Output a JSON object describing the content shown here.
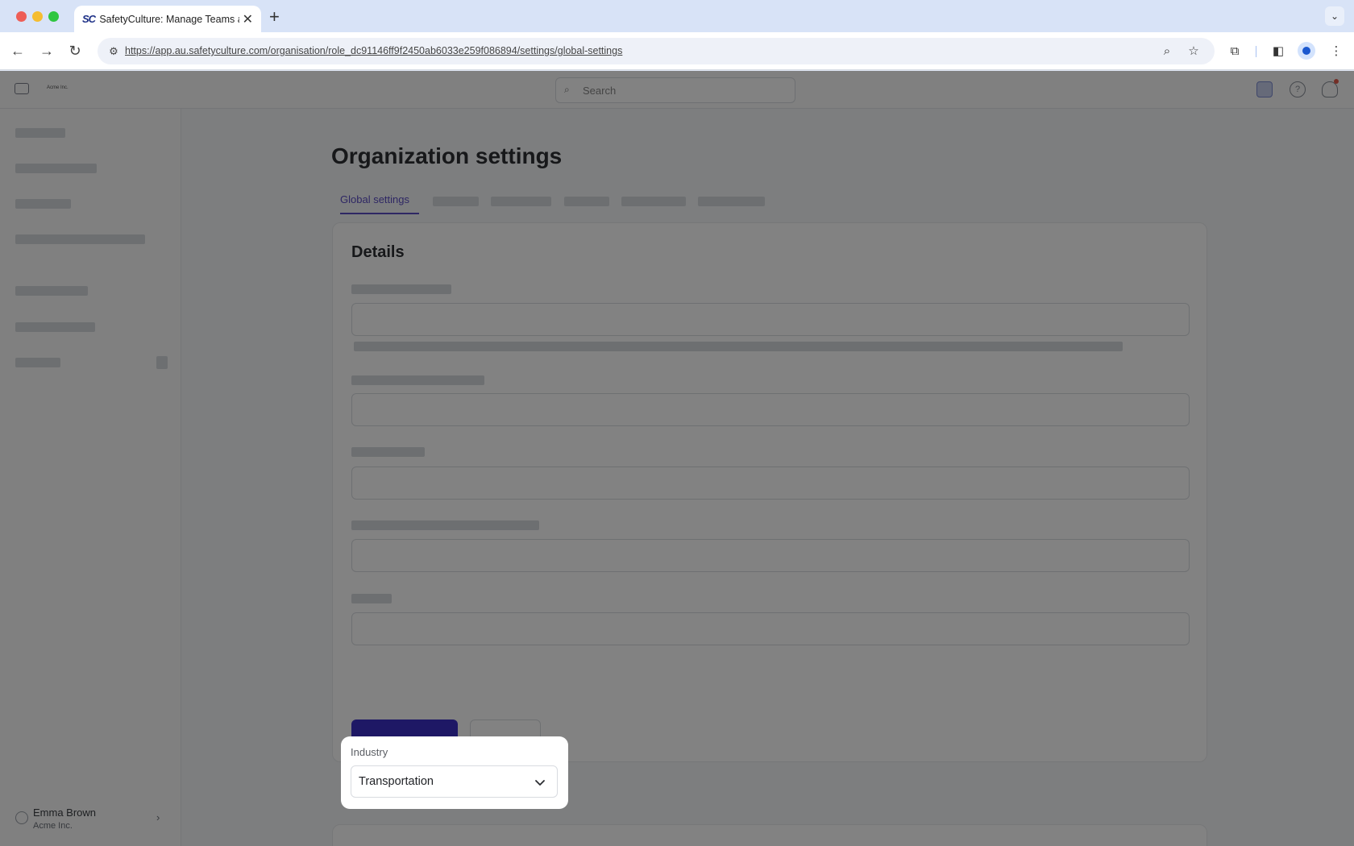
{
  "browser": {
    "tab_title": "SafetyCulture: Manage Teams and...",
    "favicon_text": "SC",
    "tab_close": "✕",
    "new_tab": "+",
    "url": "https://app.au.safetyculture.com/organisation/role_dc91146ff9f2450ab6033e259f086894/settings/global-settings"
  },
  "app": {
    "org_logo": "Acme Inc.",
    "search_placeholder": "Search",
    "page_title": "Organization settings",
    "active_tab": "Global settings",
    "card_title": "Details",
    "user": {
      "name": "Emma Brown",
      "org": "Acme Inc."
    }
  },
  "industry_field": {
    "label": "Industry",
    "value": "Transportation"
  },
  "colors": {
    "accent": "#5b4dc4",
    "primary_button": "#3b30c6",
    "overlay": "rgba(0,0,0,0.49)"
  }
}
